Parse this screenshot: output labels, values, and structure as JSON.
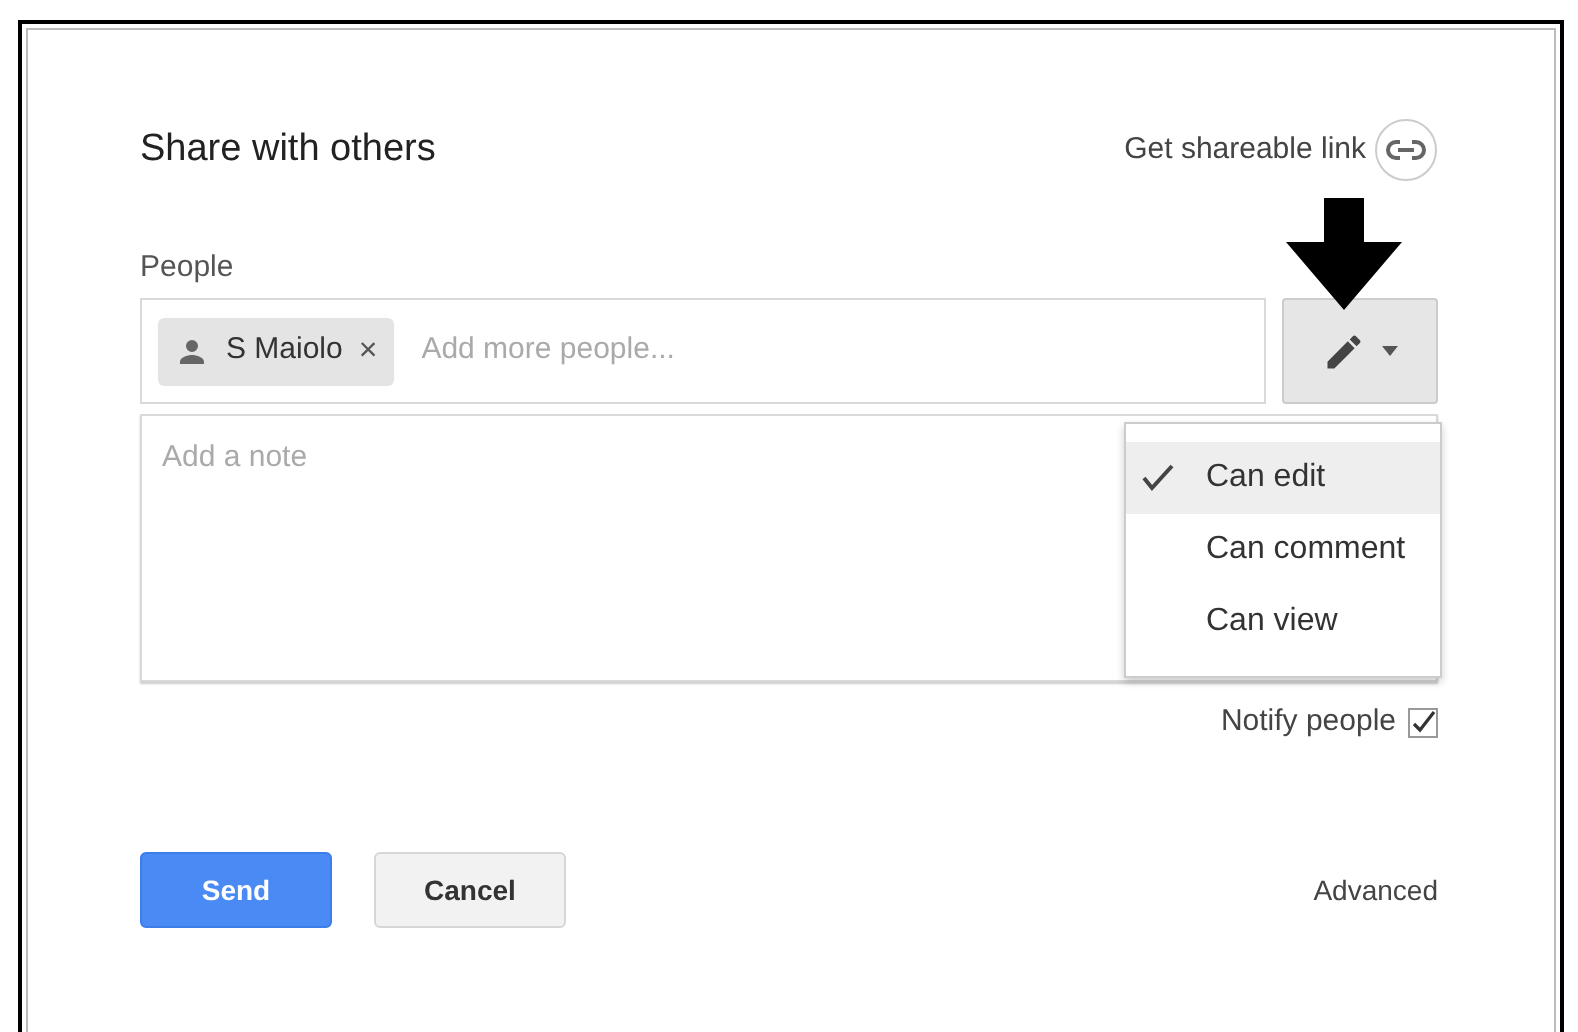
{
  "dialog": {
    "title": "Share with others",
    "shareable_link": "Get shareable link",
    "people_label": "People",
    "chips": [
      {
        "name": "S Maiolo",
        "remove": "×"
      }
    ],
    "people_placeholder": "Add more people...",
    "note_placeholder": "Add a note",
    "permission_menu": {
      "expanded": true,
      "items": [
        {
          "label": "Can edit",
          "selected": true
        },
        {
          "label": "Can comment",
          "selected": false
        },
        {
          "label": "Can view",
          "selected": false
        }
      ]
    },
    "notify": {
      "label": "Notify people",
      "checked": true
    },
    "buttons": [
      {
        "label": "Send",
        "kind": "primary"
      },
      {
        "label": "Cancel",
        "kind": "secondary"
      }
    ],
    "advanced": "Advanced"
  }
}
